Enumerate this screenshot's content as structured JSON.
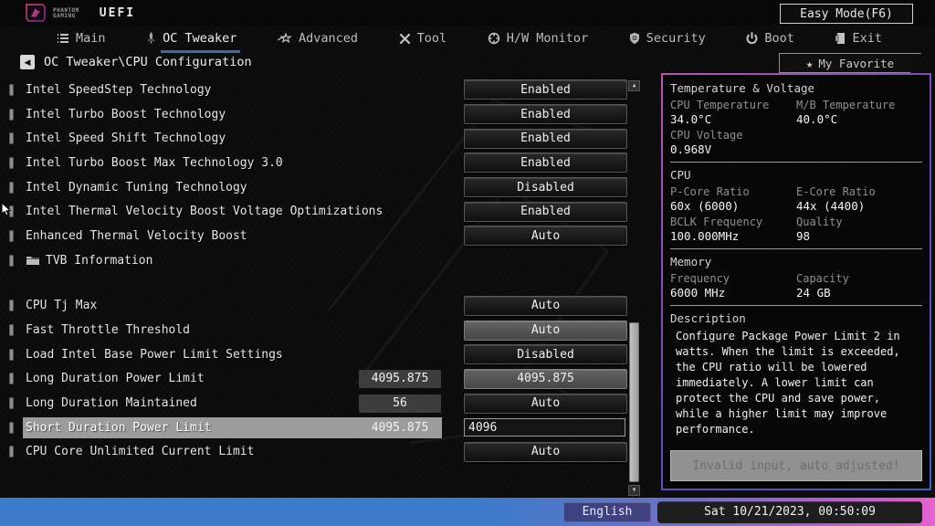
{
  "header": {
    "brand_line1": "PHANTOM",
    "brand_line2": "GAMING",
    "uefi": "UEFI",
    "easy_mode_label": "Easy Mode(F6)"
  },
  "tabs": [
    {
      "label": "Main",
      "icon": "menu",
      "active": false
    },
    {
      "label": "OC Tweaker",
      "icon": "rocket",
      "active": true
    },
    {
      "label": "Advanced",
      "icon": "star",
      "active": false
    },
    {
      "label": "Tool",
      "icon": "tools",
      "active": false
    },
    {
      "label": "H/W Monitor",
      "icon": "monitor",
      "active": false
    },
    {
      "label": "Security",
      "icon": "shield",
      "active": false
    },
    {
      "label": "Boot",
      "icon": "power",
      "active": false
    },
    {
      "label": "Exit",
      "icon": "exit",
      "active": false
    }
  ],
  "breadcrumb": {
    "back_icon": "◀",
    "path": "OC Tweaker\\CPU Configuration",
    "star_icon": "★",
    "my_favorite_label": "My Favorite"
  },
  "settings": {
    "groups": [
      [
        {
          "label": "Intel SpeedStep Technology",
          "control": "dropdown",
          "value": "Enabled"
        },
        {
          "label": "Intel Turbo Boost Technology",
          "control": "dropdown",
          "value": "Enabled"
        },
        {
          "label": "Intel Speed Shift Technology",
          "control": "dropdown",
          "value": "Enabled"
        },
        {
          "label": "Intel Turbo Boost Max Technology 3.0",
          "control": "dropdown",
          "value": "Enabled"
        },
        {
          "label": "Intel Dynamic Tuning Technology",
          "control": "dropdown",
          "value": "Disabled"
        },
        {
          "label": "Intel Thermal Velocity Boost Voltage Optimizations",
          "control": "dropdown",
          "value": "Enabled"
        },
        {
          "label": "Enhanced Thermal Velocity Boost",
          "control": "dropdown",
          "value": "Auto"
        },
        {
          "label": "TVB Information",
          "control": "none",
          "icon": "folder"
        }
      ],
      [
        {
          "label": "CPU Tj Max",
          "control": "dropdown",
          "value": "Auto"
        },
        {
          "label": "Fast Throttle Threshold",
          "control": "dropdown",
          "value": "Auto",
          "light": true
        },
        {
          "label": "Load Intel Base Power Limit Settings",
          "control": "dropdown",
          "value": "Disabled"
        },
        {
          "label": "Long Duration Power Limit",
          "inline": "4095.875",
          "control": "dropdown",
          "value": "4095.875",
          "light": true
        },
        {
          "label": "Long Duration Maintained",
          "inline": "56",
          "control": "dropdown",
          "value": "Auto"
        },
        {
          "label": "Short Duration Power Limit",
          "inline": "4095.875",
          "control": "input",
          "value": "4096",
          "selected": true
        },
        {
          "label": "CPU Core Unlimited Current Limit",
          "control": "dropdown",
          "value": "Auto"
        }
      ]
    ]
  },
  "scrollbar": {
    "up_icon": "▲",
    "down_icon": "▼"
  },
  "info_panel": {
    "sections": [
      {
        "title": "Temperature & Voltage",
        "fields": [
          {
            "label": "CPU Temperature",
            "value": "34.0°C"
          },
          {
            "label": "M/B Temperature",
            "value": "40.0°C"
          },
          {
            "label": "CPU Voltage",
            "value": "0.968V"
          }
        ]
      },
      {
        "title": "CPU",
        "fields": [
          {
            "label": "P-Core Ratio",
            "value": "60x (6000)"
          },
          {
            "label": "E-Core Ratio",
            "value": "44x (4400)"
          },
          {
            "label": "BCLK Frequency",
            "value": "100.000MHz"
          },
          {
            "label": "Quality",
            "value": "98"
          }
        ]
      },
      {
        "title": "Memory",
        "fields": [
          {
            "label": "Frequency",
            "value": "6000 MHz"
          },
          {
            "label": "Capacity",
            "value": "24 GB"
          }
        ]
      },
      {
        "title": "Description",
        "text": "Configure Package Power Limit 2 in watts. When the limit is exceeded, the CPU ratio will be lowered immediately. A lower limit can protect the CPU and save power, while a higher limit may improve performance."
      }
    ],
    "toast": "Invalid input, auto adjusted!"
  },
  "footer": {
    "language": "English",
    "datetime": "Sat 10/21/2023, 00:50:09"
  },
  "colors": {
    "accent_underline": "#3a6ca8",
    "panel_border_purple": "#b657b0",
    "panel_border_blue": "#3f62c2",
    "footer_gradient_left": "#3d7bca",
    "footer_gradient_right": "#e664d2",
    "highlight_row": "#9c9c9c"
  }
}
